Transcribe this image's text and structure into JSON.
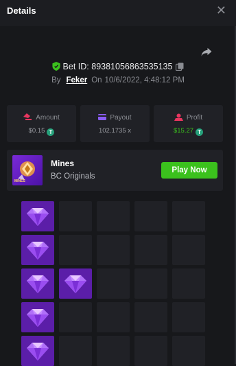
{
  "header": {
    "title": "Details",
    "close_symbol": "✕"
  },
  "bet": {
    "id_label": "Bet ID:",
    "id_value": "89381056863535135",
    "by_label": "By",
    "user": "Feker",
    "on_label": "On",
    "date": "10/6/2022, 4:48:12 PM"
  },
  "stats": {
    "amount": {
      "label": "Amount",
      "value": "$0.15"
    },
    "payout": {
      "label": "Payout",
      "value": "102.1735 x"
    },
    "profit": {
      "label": "Profit",
      "value": "$15.27"
    }
  },
  "game": {
    "name": "Mines",
    "provider": "BC Originals",
    "play_label": "Play Now",
    "thumb_tag": "MINES"
  },
  "token_symbol": "T",
  "colors": {
    "background": "#17181b",
    "panel": "#202126",
    "accent_green": "#3bc11d",
    "gem_tile": "#5b1ea8"
  },
  "mines_grid": {
    "rows_visible": 5,
    "columns": 5,
    "cells": [
      [
        "gem",
        "hidden",
        "hidden",
        "hidden",
        "hidden"
      ],
      [
        "gem",
        "hidden",
        "hidden",
        "hidden",
        "hidden"
      ],
      [
        "gem",
        "gem",
        "hidden",
        "hidden",
        "hidden"
      ],
      [
        "gem",
        "hidden",
        "hidden",
        "hidden",
        "hidden"
      ],
      [
        "gem",
        "hidden",
        "hidden",
        "hidden",
        "hidden"
      ]
    ]
  }
}
